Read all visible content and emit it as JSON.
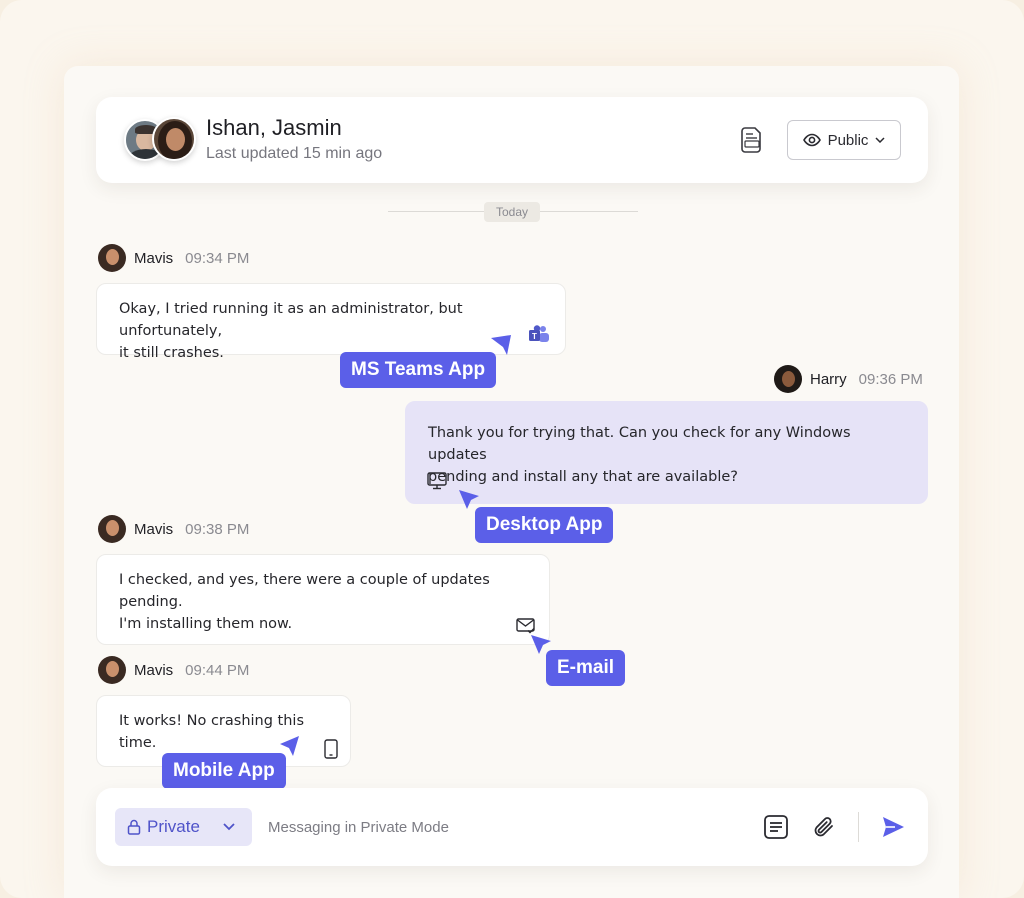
{
  "header": {
    "title": "Ishan, Jasmin",
    "subtitle": "Last updated 15 min ago",
    "visibility_label": "Public"
  },
  "divider": {
    "label": "Today"
  },
  "messages": [
    {
      "sender": "Mavis",
      "time": "09:34 PM",
      "lines": [
        "Okay, I tried running it as an administrator, but unfortunately,",
        "it still crashes."
      ],
      "channel_icon": "ms-teams-icon",
      "callout": "MS Teams App"
    },
    {
      "sender": "Harry",
      "time": "09:36 PM",
      "lines": [
        "Thank you for trying that. Can you check for any Windows updates",
        "pending and install any that are available?"
      ],
      "channel_icon": "desktop-icon",
      "callout": "Desktop App"
    },
    {
      "sender": "Mavis",
      "time": "09:38 PM",
      "lines": [
        "I checked, and yes, there were a couple of updates pending.",
        "I'm installing them now."
      ],
      "channel_icon": "email-icon",
      "callout": "E-mail"
    },
    {
      "sender": "Mavis",
      "time": "09:44 PM",
      "lines": [
        "It works! No crashing this time."
      ],
      "channel_icon": "mobile-icon",
      "callout": "Mobile App"
    }
  ],
  "composer": {
    "mode_label": "Private",
    "placeholder": "Messaging in Private Mode"
  },
  "colors": {
    "accent": "#5b5fe8",
    "own_bubble": "#e6e3f7",
    "mode_bg": "#e7e6f8"
  }
}
